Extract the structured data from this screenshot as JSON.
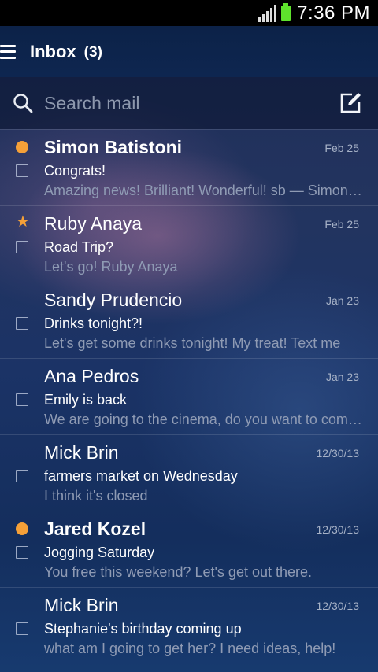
{
  "status_bar": {
    "time": "7:36 PM"
  },
  "app_bar": {
    "title": "Inbox",
    "count": "(3)"
  },
  "search": {
    "placeholder": "Search mail"
  },
  "colors": {
    "accent": "#f5a038",
    "header": "#0e2650",
    "battery": "#5ee22c"
  },
  "messages": [
    {
      "sender": "Simon Batistoni",
      "date": "Feb 25",
      "subject": "Congrats!",
      "preview": "Amazing news! Brilliant!  Wonderful!  sb — Simon Batistoni",
      "marker": "unread-dot"
    },
    {
      "sender": "Ruby Anaya",
      "date": "Feb 25",
      "subject": "Road Trip?",
      "preview": "Let's go! Ruby Anaya",
      "marker": "star"
    },
    {
      "sender": "Sandy Prudencio",
      "date": "Jan 23",
      "subject": "Drinks tonight?!",
      "preview": "Let's get some drinks tonight! My treat! Text me",
      "marker": "none"
    },
    {
      "sender": "Ana Pedros",
      "date": "Jan 23",
      "subject": "Emily is back",
      "preview": "We are going to the cinema, do you want to come?",
      "marker": "none"
    },
    {
      "sender": "Mick Brin",
      "date": "12/30/13",
      "subject": "farmers market on Wednesday",
      "preview": "I think it's closed",
      "marker": "none"
    },
    {
      "sender": "Jared Kozel",
      "date": "12/30/13",
      "subject": "Jogging Saturday",
      "preview": "You free this weekend? Let's get out there.",
      "marker": "unread-dot"
    },
    {
      "sender": "Mick Brin",
      "date": "12/30/13",
      "subject": "Stephanie's birthday coming up",
      "preview": "what am I going to get her? I need ideas, help!",
      "marker": "none"
    }
  ]
}
